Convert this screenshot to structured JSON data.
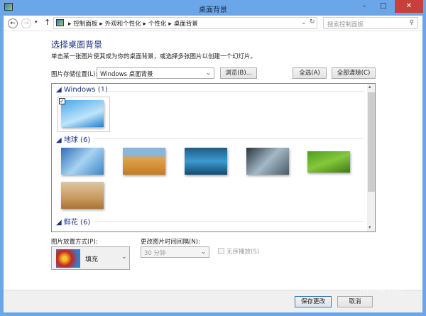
{
  "window": {
    "title": "桌面背景",
    "minimize": "–",
    "maximize": "□",
    "close": "✕"
  },
  "address": {
    "crumbs": [
      "控制面板",
      "外观和个性化",
      "个性化",
      "桌面背景"
    ],
    "search_placeholder": "搜索控制面板"
  },
  "main": {
    "heading": "选择桌面背景",
    "description": "单击某一张图片使其成为你的桌面背景，或选择多张图片以创建一个幻灯片。",
    "location_label": "图片存储位置(L):",
    "location_value": "Windows 桌面背景",
    "browse": "浏览(B)...",
    "select_all": "全选(A)",
    "clear_all": "全部清除(C)",
    "groups": [
      {
        "name": "Windows (1)"
      },
      {
        "name": "地球 (6)"
      },
      {
        "name": "鲜花 (6)"
      }
    ],
    "position_label": "图片放置方式(P):",
    "position_value": "填充",
    "interval_label": "更改图片时间间隔(N):",
    "interval_value": "30 分钟",
    "shuffle_label": "无序播放(S)"
  },
  "footer": {
    "save": "保存更改",
    "cancel": "取消"
  },
  "watermark": {
    "text": "路由器",
    "url": "luyouqi.com"
  }
}
